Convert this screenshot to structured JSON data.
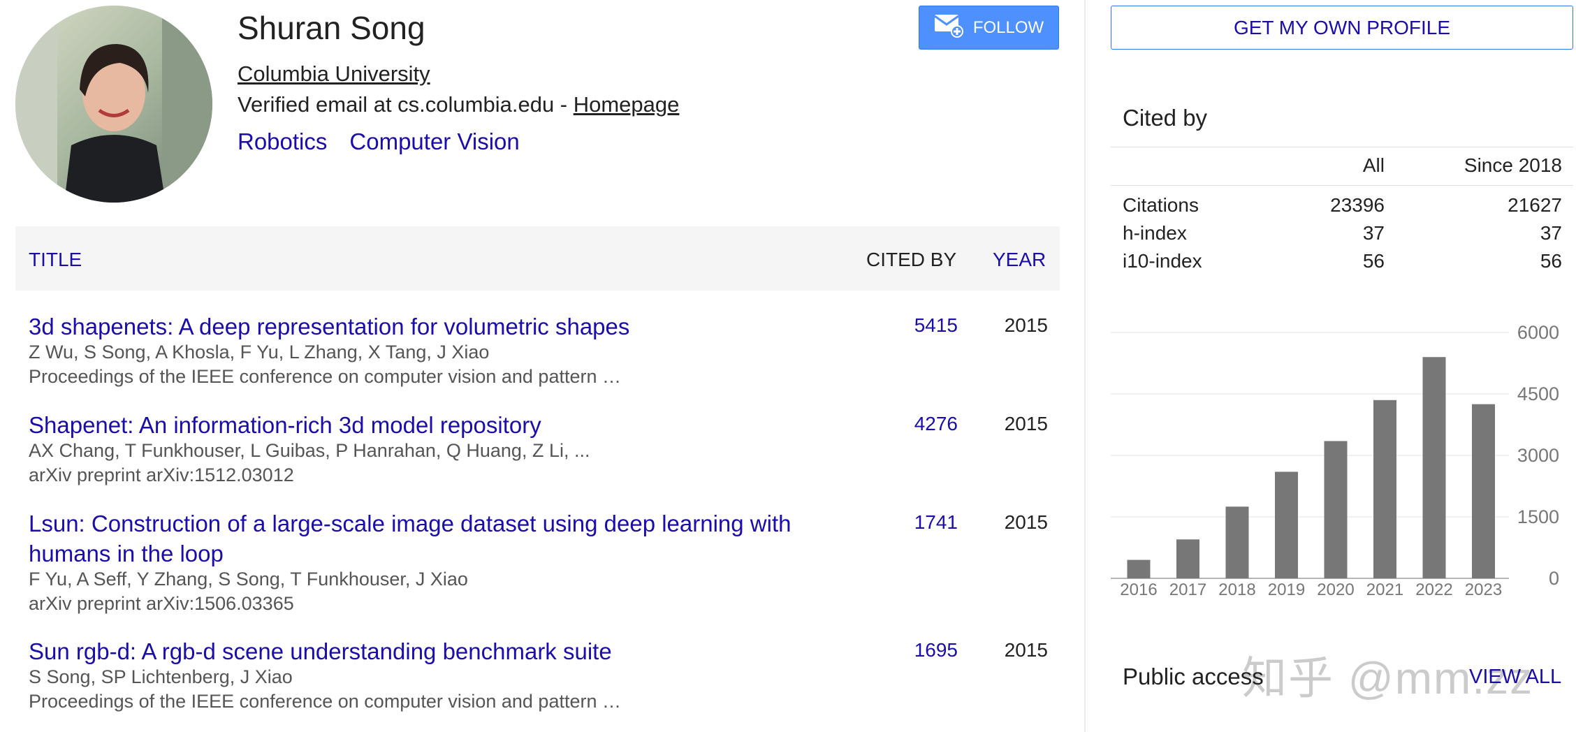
{
  "profile": {
    "name": "Shuran Song",
    "affiliation": "Columbia University",
    "email_text": "Verified email at cs.columbia.edu - ",
    "homepage_label": "Homepage",
    "interests": [
      "Robotics",
      "Computer Vision"
    ],
    "follow_label": "FOLLOW"
  },
  "table": {
    "col_title": "TITLE",
    "col_cited": "CITED BY",
    "col_year": "YEAR",
    "articles": [
      {
        "title": "3d shapenets: A deep representation for volumetric shapes",
        "authors": "Z Wu, S Song, A Khosla, F Yu, L Zhang, X Tang, J Xiao",
        "venue": "Proceedings of the IEEE conference on computer vision and pattern …",
        "cites": "5415",
        "year": "2015"
      },
      {
        "title": "Shapenet: An information-rich 3d model repository",
        "authors": "AX Chang, T Funkhouser, L Guibas, P Hanrahan, Q Huang, Z Li, ...",
        "venue": "arXiv preprint arXiv:1512.03012",
        "cites": "4276",
        "year": "2015"
      },
      {
        "title": "Lsun: Construction of a large-scale image dataset using deep learning with humans in the loop",
        "authors": "F Yu, A Seff, Y Zhang, S Song, T Funkhouser, J Xiao",
        "venue": "arXiv preprint arXiv:1506.03365",
        "cites": "1741",
        "year": "2015"
      },
      {
        "title": "Sun rgb-d: A rgb-d scene understanding benchmark suite",
        "authors": "S Song, SP Lichtenberg, J Xiao",
        "venue": "Proceedings of the IEEE conference on computer vision and pattern …",
        "cites": "1695",
        "year": "2015"
      }
    ]
  },
  "sidebar": {
    "own_profile_label": "GET MY OWN PROFILE",
    "cited_by_title": "Cited by",
    "stats_head": {
      "all": "All",
      "since": "Since 2018"
    },
    "stats": [
      {
        "label": "Citations",
        "all": "23396",
        "since": "21627"
      },
      {
        "label": "h-index",
        "all": "37",
        "since": "37"
      },
      {
        "label": "i10-index",
        "all": "56",
        "since": "56"
      }
    ],
    "public_access_title": "Public access",
    "view_all_label": "VIEW ALL",
    "watermark": "知乎 @mm.zz"
  },
  "chart_data": {
    "type": "bar",
    "categories": [
      "2016",
      "2017",
      "2018",
      "2019",
      "2020",
      "2021",
      "2022",
      "2023"
    ],
    "values": [
      450,
      950,
      1750,
      2600,
      3350,
      4350,
      5400,
      4250
    ],
    "y_ticks": [
      0,
      1500,
      3000,
      4500,
      6000
    ],
    "ylim": [
      0,
      6000
    ],
    "bar_color": "#777777",
    "grid": true
  }
}
